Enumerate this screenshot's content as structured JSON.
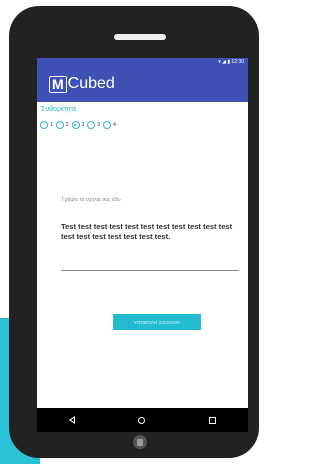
{
  "app": {
    "title": "Cubed",
    "logo_letter": "M",
    "status_icons": "▾ ◢ ▮ 12:30"
  },
  "question": {
    "section_title": "Συθορέτητε",
    "options": [
      {
        "label": "1",
        "checked": false
      },
      {
        "label": "2",
        "checked": false
      },
      {
        "label": "3",
        "checked": true
      },
      {
        "label": "3",
        "checked": false
      },
      {
        "label": "4",
        "checked": false
      }
    ],
    "prompt": "Γράψτε τα σχόλια σας εδώ",
    "answer_text": "Test test test test test test test test test test test test test test test test test test."
  },
  "actions": {
    "submit_label": "ΥΠΟΒΟΛΗ ΣΧΟΛΙΟΥ"
  },
  "colors": {
    "appbar": "#3f51b5",
    "accent": "#23bccf"
  },
  "icons": [
    "back-icon",
    "home-icon",
    "recents-icon"
  ]
}
